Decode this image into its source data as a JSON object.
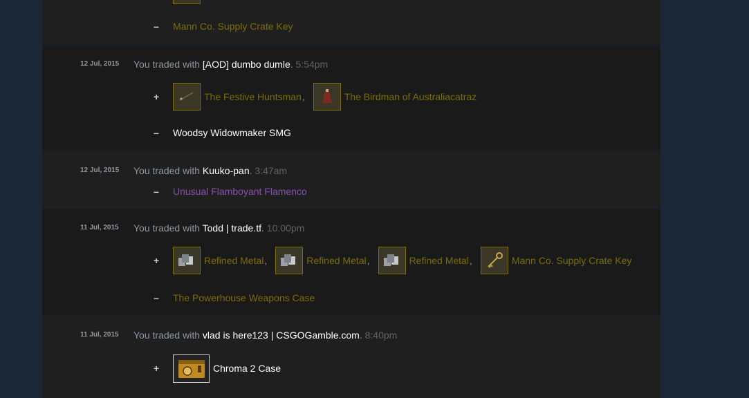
{
  "trades": [
    {
      "date": "",
      "partner": "",
      "time": "",
      "received": [],
      "given": [
        {
          "name": "Mann Co. Supply Crate Key",
          "quality": "gold"
        }
      ]
    },
    {
      "date": "12 Jul, 2015",
      "prefix": "You traded with",
      "partner": "[AOD] dumbo dumle",
      "time": "5:54pm",
      "received": [
        {
          "name": "The Festive Huntsman",
          "quality": "gold",
          "icon": "bow-icon"
        },
        {
          "name": "The Birdman of Australiacatraz",
          "quality": "gold",
          "icon": "bird-hat-icon"
        }
      ],
      "given": [
        {
          "name": "Woodsy Widowmaker SMG",
          "quality": "white"
        }
      ]
    },
    {
      "date": "12 Jul, 2015",
      "prefix": "You traded with",
      "partner": "Kuuko-pan",
      "time": "3:47am",
      "received": [],
      "given": [
        {
          "name": "Unusual Flamboyant Flamenco",
          "quality": "purple"
        }
      ]
    },
    {
      "date": "11 Jul, 2015",
      "prefix": "You traded with",
      "partner": "Todd | trade.tf",
      "time": "10:00pm",
      "received": [
        {
          "name": "Refined Metal",
          "quality": "gold",
          "icon": "metal-icon"
        },
        {
          "name": "Refined Metal",
          "quality": "gold",
          "icon": "metal-icon"
        },
        {
          "name": "Refined Metal",
          "quality": "gold",
          "icon": "metal-icon"
        },
        {
          "name": "Mann Co. Supply Crate Key",
          "quality": "gold",
          "icon": "key-icon"
        }
      ],
      "given": [
        {
          "name": "The Powerhouse Weapons Case",
          "quality": "gold"
        }
      ]
    },
    {
      "date": "11 Jul, 2015",
      "prefix": "You traded with",
      "partner": "vlad is here123 | CSGOGamble.com",
      "time": "8:40pm",
      "received": [
        {
          "name": "Chroma 2 Case",
          "quality": "white",
          "icon": "case-icon"
        }
      ],
      "given": []
    }
  ],
  "signs": {
    "plus": "+",
    "minus": "–",
    "comma": ","
  },
  "colors": {
    "page_bg": "#1b2838",
    "panel_bg": "#1f1f1f",
    "gold": "#7d6d00",
    "purple": "#8650ac",
    "white": "#ffffff",
    "muted": "#8f98a0"
  }
}
